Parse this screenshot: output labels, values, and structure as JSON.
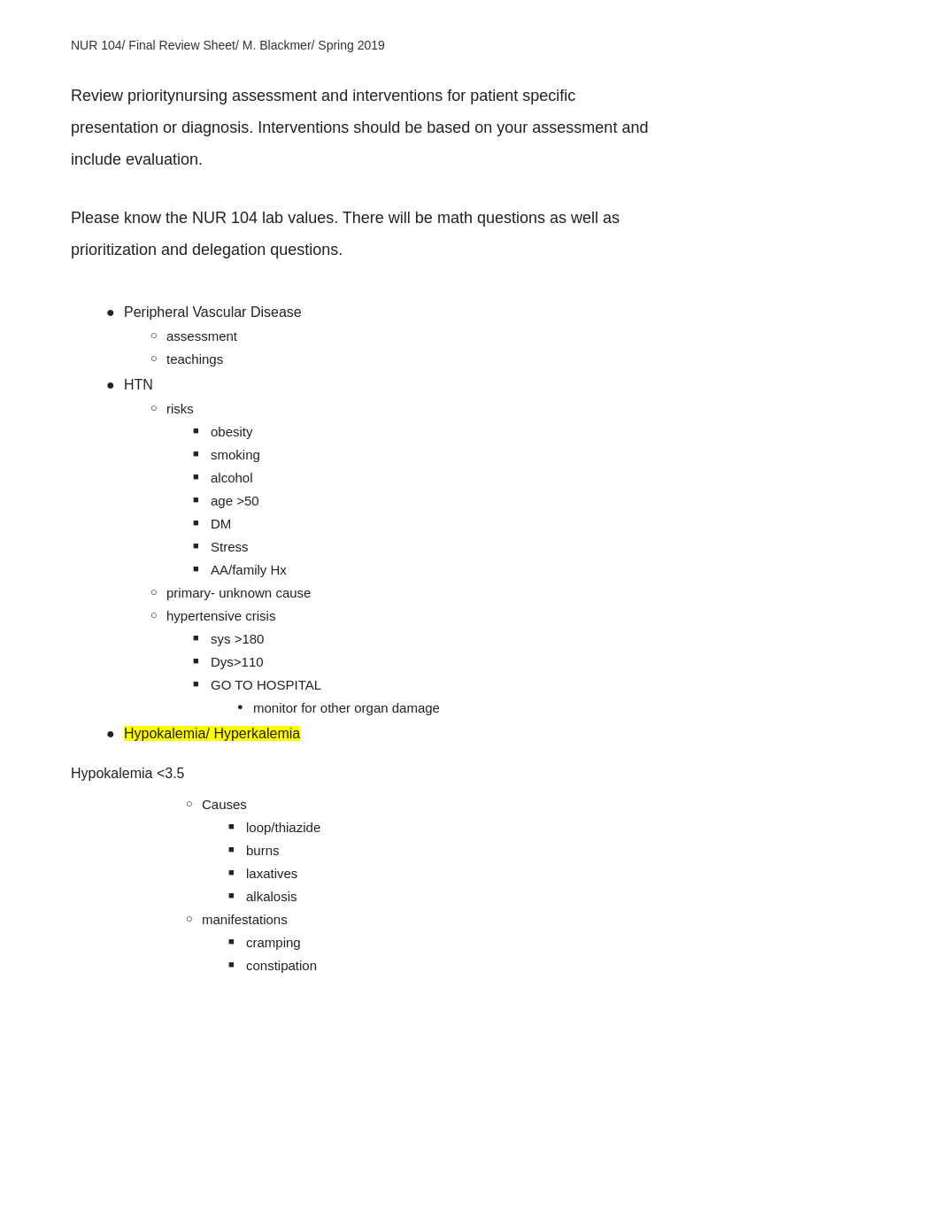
{
  "header": {
    "text": "NUR 104/ Final Review Sheet/ M. Blackmer/ Spring 2019"
  },
  "intro": {
    "line1": "Review prioritynursing assessment and interventions   for patient specific",
    "line2": "presentation or diagnosis.   Interventions should be based on your assessment and",
    "line3": "include evaluation."
  },
  "second": {
    "line1": "Please know the NUR 104 lab values. There will be math questions as well as",
    "line2": "prioritization and delegation questions."
  },
  "bullet_list": [
    {
      "label": "Peripheral Vascular Disease",
      "highlighted": false,
      "children": [
        {
          "label": "assessment",
          "children": []
        },
        {
          "label": "teachings",
          "children": []
        }
      ]
    },
    {
      "label": "HTN",
      "highlighted": false,
      "children": [
        {
          "label": "risks",
          "children": [
            {
              "label": "obesity"
            },
            {
              "label": "smoking"
            },
            {
              "label": "alcohol"
            },
            {
              "label": "age >50"
            },
            {
              "label": "DM"
            },
            {
              "label": "Stress"
            },
            {
              "label": "AA/family Hx"
            }
          ]
        },
        {
          "label": "primary- unknown cause",
          "children": []
        },
        {
          "label": "hypertensive crisis",
          "children": [
            {
              "label": "sys >180"
            },
            {
              "label": "Dys>110"
            },
            {
              "label": "GO TO HOSPITAL",
              "sub": [
                "monitor for other organ damage"
              ]
            }
          ]
        }
      ]
    },
    {
      "label": "Hypokalemia/ Hyperkalemia",
      "highlighted": true,
      "children": []
    }
  ],
  "hypokalemia_section": {
    "title": "Hypokalemia <3.5",
    "groups": [
      {
        "label": "Causes",
        "items": [
          "loop/thiazide",
          "burns",
          "laxatives",
          "alkalosis"
        ]
      },
      {
        "label": "manifestations",
        "items": [
          "cramping",
          "constipation"
        ]
      }
    ]
  }
}
